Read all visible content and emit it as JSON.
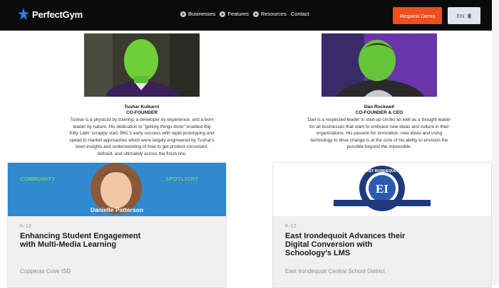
{
  "header": {
    "brand": "PerfectGym",
    "nav": [
      {
        "label": "Businesses"
      },
      {
        "label": "Features"
      },
      {
        "label": "Resources"
      },
      {
        "label": "Contact"
      }
    ],
    "cta_label": "Request Demo",
    "language": "EN"
  },
  "team": [
    {
      "name": "Tushar Kulkarni",
      "role": "CO-FOUNDER",
      "bio_lines": [
        "Tushar is a physicist by training, a developer by experience, and a born",
        "leader by nature. His dedication to \"getting things done\" enabled Big",
        "Kitty Labs' scrappy start, BKL's early success with rapid prototyping and",
        "speed to market approaches which were largely engineered by Tushar's",
        "keen insights and understanding of how to get product conceived,",
        "defined, and ultimately across the finish line."
      ]
    },
    {
      "name": "Dan Rockwell",
      "role": "CO-FOUNDER & CEO",
      "bio_lines": [
        "Dan is a respected leader in start-up circles as well as a thought leader",
        "for all businesses that want to embrace new ideas and culture in their",
        "organizations. His passion for innovation, new ideas and using",
        "technology to drive change is at the core of his ability to envision the",
        "possible beyond the impossible."
      ]
    }
  ],
  "cards": [
    {
      "image_left_label": "COMMUNITY",
      "image_right_label": "SPOTLIGHT",
      "image_person": "Danielle Patterson",
      "tag": "K-12",
      "title_lines": [
        "Enhancing Student Engagement",
        "with Multi-Media Learning"
      ],
      "footer": "Copperas Cove ISD"
    },
    {
      "seal_text": "EAST IRONDEQUOIT",
      "seal_letters": "EI",
      "tag": "K-12",
      "title_lines": [
        "East Irondequoit Advances their",
        "Digital Conversion with",
        "Schoology's LMS"
      ],
      "footer": "East Irondequoit Central School District"
    }
  ],
  "colors": {
    "header_bg": "#0b0b0b",
    "cta_bg": "#f04e1d",
    "brand_accent": "#2f7fd6",
    "spotlight_green": "#7ccf4b",
    "spotlight_blue": "#2f8ad0",
    "seal_navy": "#1f3a7a"
  },
  "icons": {
    "logo": "perfectgym-star-logo",
    "nav_bullet": "circle-play-icon",
    "language_caret": "chevron-down-icon"
  }
}
